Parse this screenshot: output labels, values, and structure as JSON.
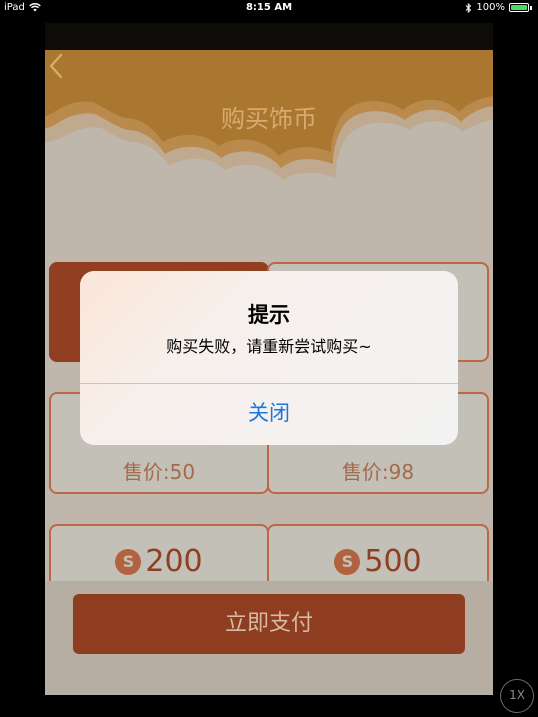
{
  "status_bar": {
    "device": "iPad",
    "time": "8:15 AM",
    "battery": "100%",
    "battery_level": 1.0
  },
  "header": {
    "title": "购买饰币",
    "back_icon": "chevron-left-icon"
  },
  "products": [
    {
      "price_label": "",
      "selected": true
    },
    {
      "price_label": "",
      "selected": false
    },
    {
      "price_label": "售价:50",
      "selected": false
    },
    {
      "price_label": "售价:98",
      "selected": false
    },
    {
      "coin_symbol": "S",
      "amount": "200"
    },
    {
      "coin_symbol": "S",
      "amount": "500"
    }
  ],
  "pay_button": {
    "label": "立即支付"
  },
  "alert": {
    "title": "提示",
    "message": "购买失败，请重新尝试购买~",
    "button": "关闭"
  },
  "zoom_button": {
    "label": "1X"
  },
  "colors": {
    "header_orange": "#d7ab6f",
    "card_border": "#bd6747",
    "selected_card": "#913e22",
    "pay_button": "#8f3d21",
    "alert_button_text": "#1a78e0"
  }
}
